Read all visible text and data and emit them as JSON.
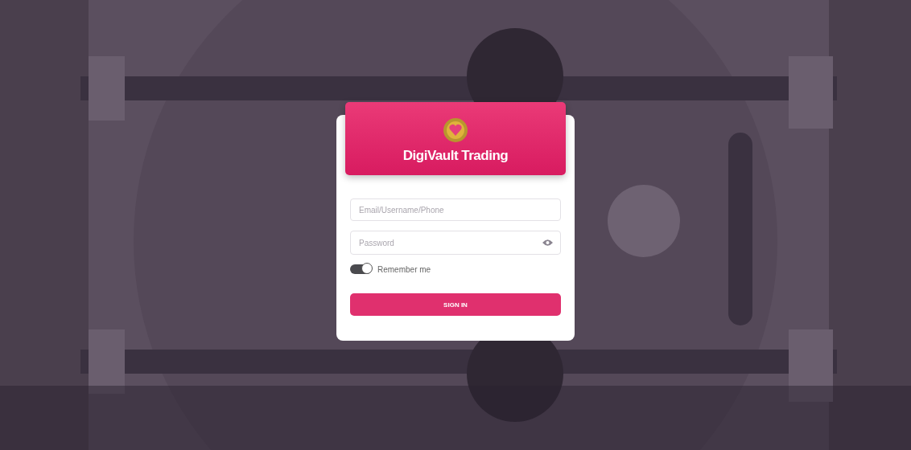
{
  "login": {
    "title": "DigiVault Trading",
    "fields": [
      {
        "kind": "text",
        "placeholder": "Email/Username/Phone"
      },
      {
        "kind": "password",
        "placeholder": "Password"
      }
    ],
    "remember": {
      "label": "Remember me",
      "on": true
    },
    "button": "SIGN IN"
  }
}
